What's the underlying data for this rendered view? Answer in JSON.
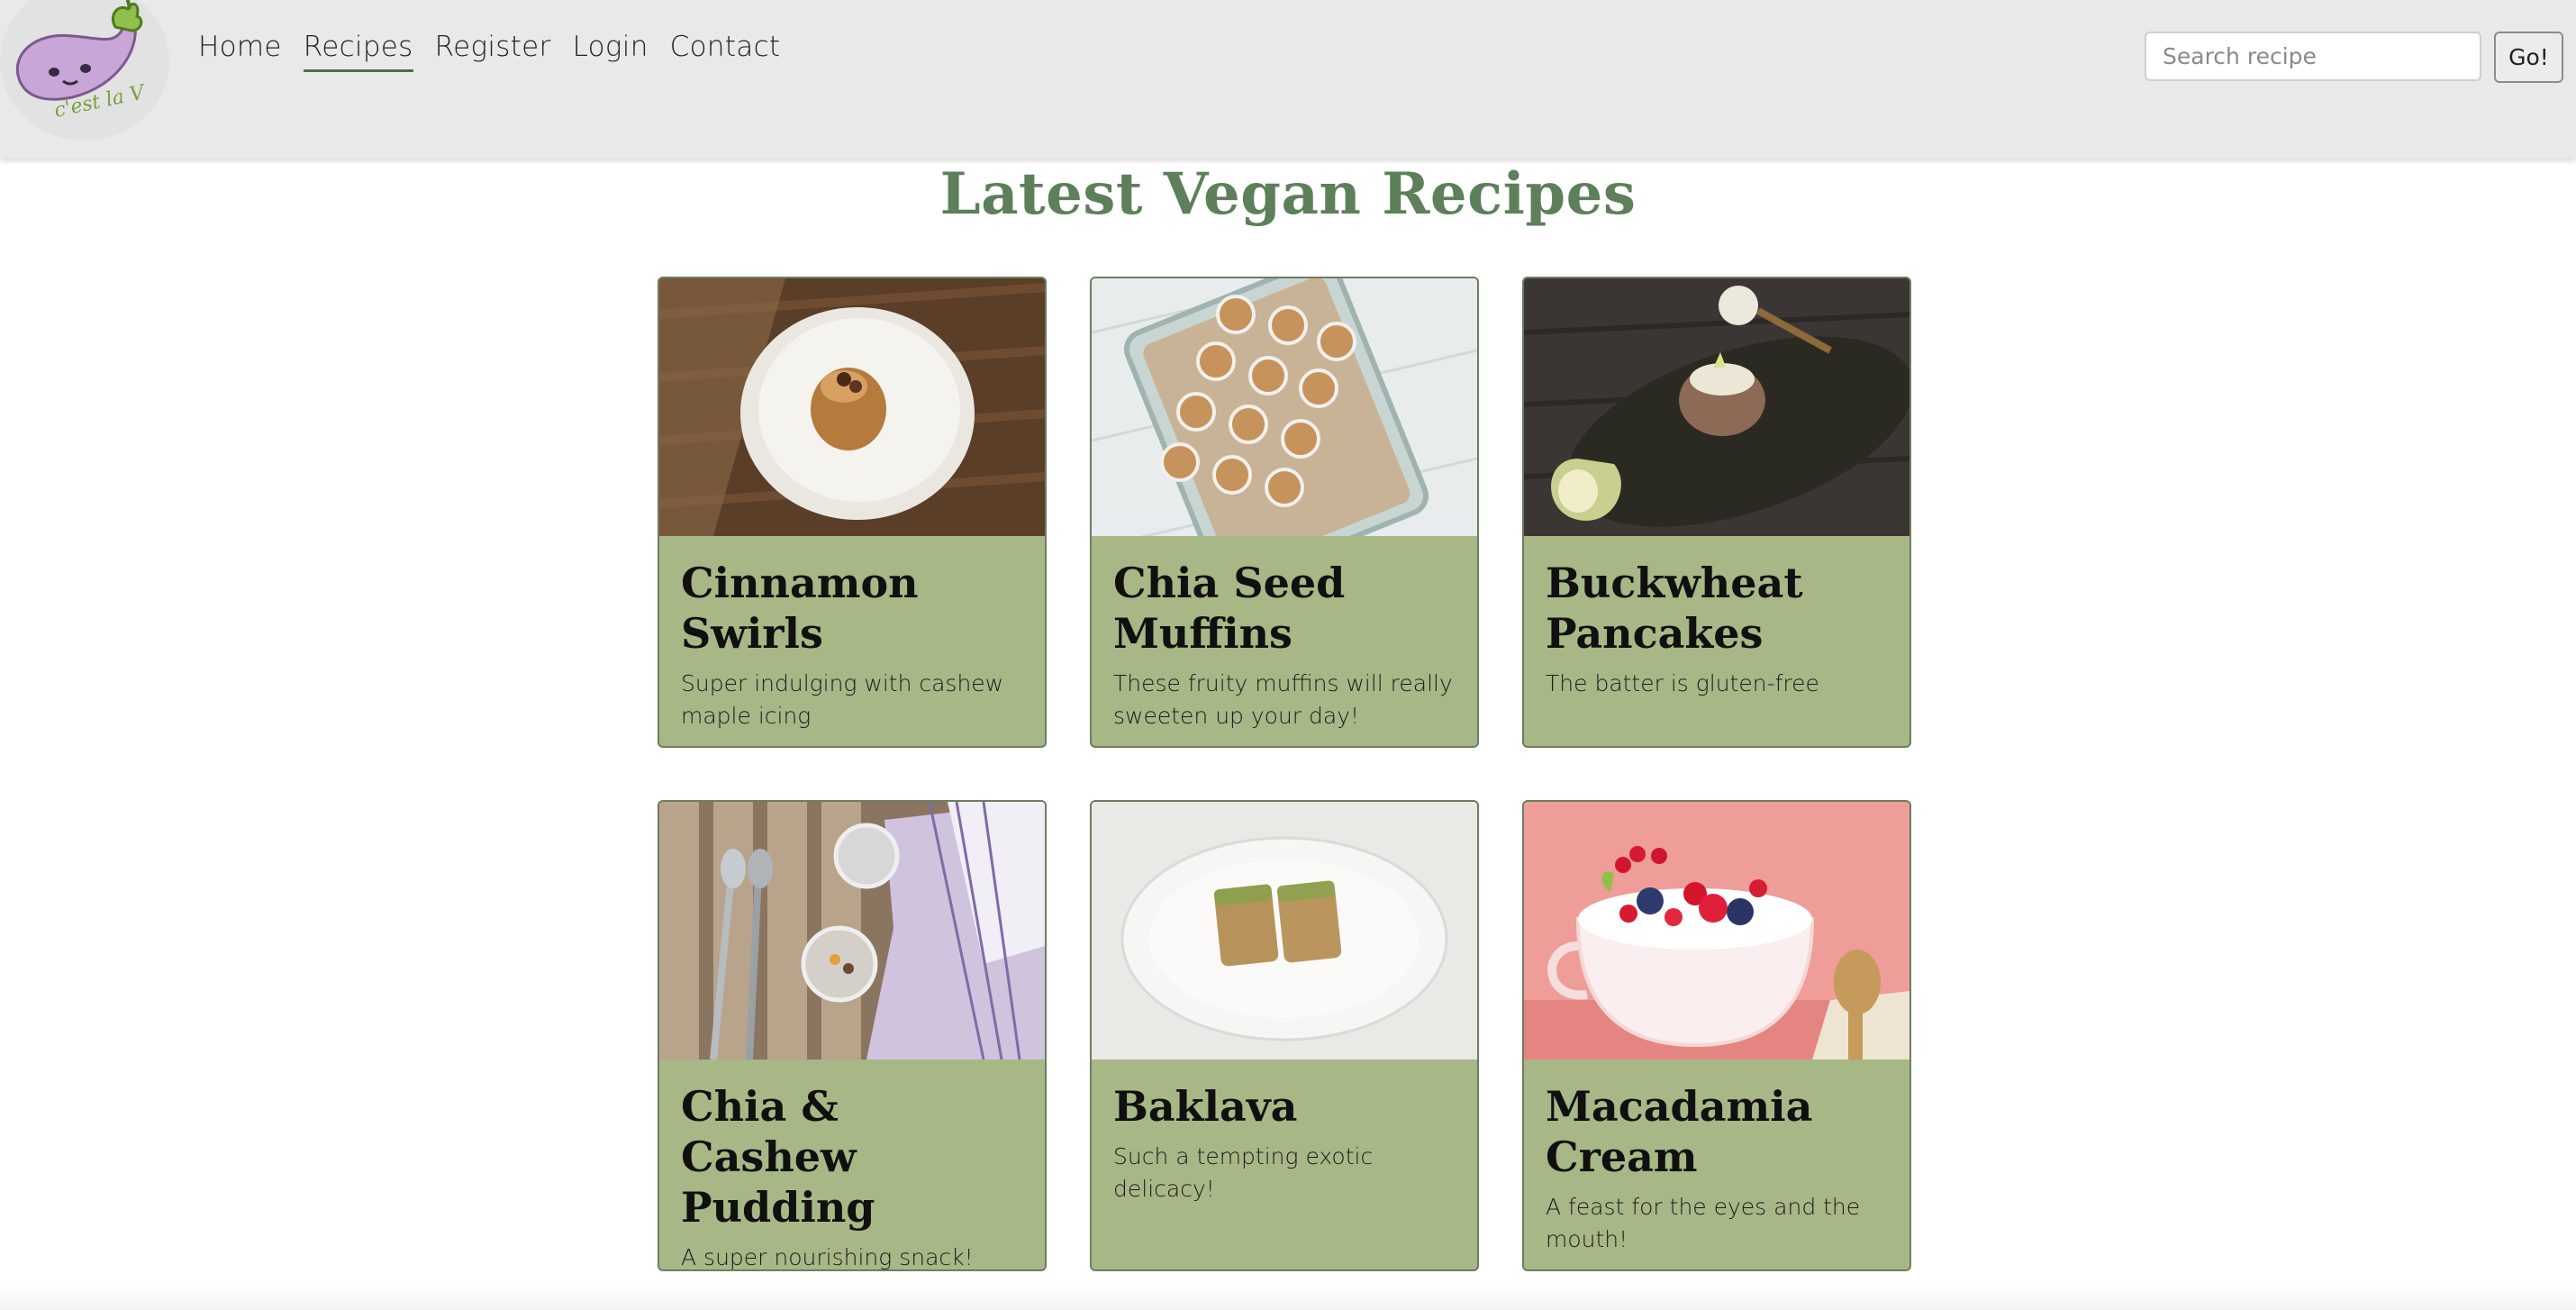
{
  "nav": {
    "logo_text": "c'est la V",
    "links": [
      {
        "label": "Home",
        "active": false
      },
      {
        "label": "Recipes",
        "active": true
      },
      {
        "label": "Register",
        "active": false
      },
      {
        "label": "Login",
        "active": false
      },
      {
        "label": "Contact",
        "active": false
      }
    ]
  },
  "search": {
    "placeholder": "Search recipe",
    "value": "",
    "button_label": "Go!"
  },
  "main": {
    "title": "Latest Vegan Recipes",
    "recipes": [
      {
        "title": "Cinnamon Swirls",
        "description": "Super indulging with cashew maple icing",
        "image_icon": "cinnamon-swirls-photo"
      },
      {
        "title": "Chia Seed Muffins",
        "description": "These fruity muffins will really sweeten up your day!",
        "image_icon": "chia-seed-muffins-photo"
      },
      {
        "title": "Buckwheat Pancakes",
        "description": "The batter is gluten-free",
        "image_icon": "buckwheat-pancakes-photo"
      },
      {
        "title": "Chia & Cashew Pudding",
        "description": "A super nourishing snack!",
        "image_icon": "chia-cashew-pudding-photo"
      },
      {
        "title": "Baklava",
        "description": "Such a tempting exotic delicacy!",
        "image_icon": "baklava-photo"
      },
      {
        "title": "Macadamia Cream",
        "description": "A feast for the eyes and the mouth!",
        "image_icon": "macadamia-cream-photo"
      }
    ]
  },
  "colors": {
    "navbar_bg": "#e9e9e9",
    "title_green": "#5d7f59",
    "card_bg": "#a7b786",
    "card_border": "#6e7d5f",
    "active_underline": "#4f6e4a"
  }
}
